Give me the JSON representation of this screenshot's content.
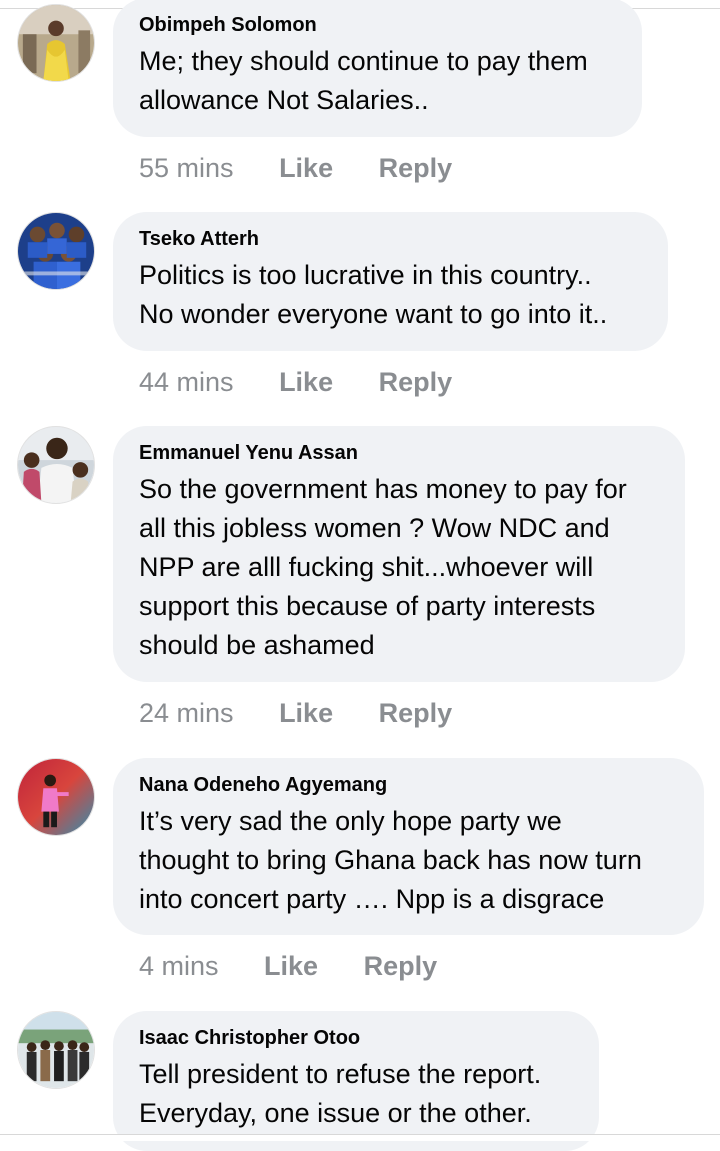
{
  "comments": [
    {
      "author": "Obimpeh Solomon",
      "text": "Me; they should continue to pay them\nallowance Not Salaries..",
      "time": "55 mins",
      "like_label": "Like",
      "reply_label": "Reply",
      "avatar_icon": "profile-photo-woman-yellow-dress"
    },
    {
      "author": "Tseko Atterh",
      "text": "Politics is too lucrative in this country..\nNo wonder everyone want to go into it..",
      "time": "44 mins",
      "like_label": "Like",
      "reply_label": "Reply",
      "avatar_icon": "profile-photo-football-team"
    },
    {
      "author": "Emmanuel Yenu Assan",
      "text": "So the government has money to pay for\nall this jobless women ? Wow NDC and\nNPP are alll fucking shit...whoever will\nsupport this because of party interests\nshould be ashamed",
      "time": "24 mins",
      "like_label": "Like",
      "reply_label": "Reply",
      "avatar_icon": "profile-photo-man-with-children"
    },
    {
      "author": "Nana Odeneho Agyemang",
      "text": "It’s very sad the only hope party we\nthought to bring Ghana back has now turn\ninto concert party …. Npp is a disgrace",
      "time": "4 mins",
      "like_label": "Like",
      "reply_label": "Reply",
      "avatar_icon": "profile-photo-man-pink-suit"
    },
    {
      "author": "Isaac Christopher Otoo",
      "text": "Tell president to refuse the report.\nEveryday, one issue or the other.",
      "time": "",
      "like_label": "",
      "reply_label": "",
      "avatar_icon": "profile-photo-group-of-men"
    }
  ],
  "colors": {
    "bubble_bg": "#f0f2f5",
    "meta_text": "#8a8d91",
    "primary_text": "#050505"
  }
}
